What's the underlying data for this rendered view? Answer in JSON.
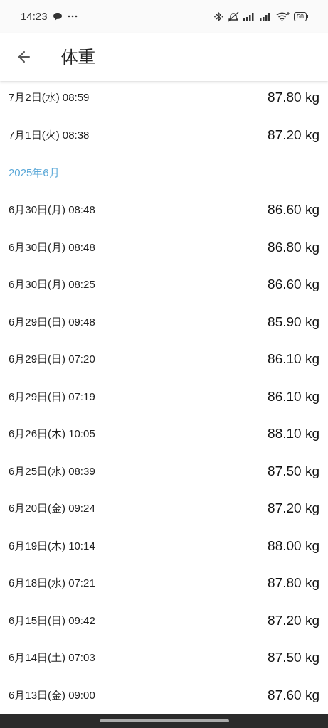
{
  "status_bar": {
    "time": "14:23",
    "battery": "58"
  },
  "header": {
    "title": "体重"
  },
  "sections": [
    {
      "rows": [
        {
          "date": "7月2日(水) 08:59",
          "weight": "87.80 kg"
        },
        {
          "date": "7月1日(火) 08:38",
          "weight": "87.20 kg"
        }
      ]
    },
    {
      "title": "2025年6月",
      "rows": [
        {
          "date": "6月30日(月) 08:48",
          "weight": "86.60 kg"
        },
        {
          "date": "6月30日(月) 08:48",
          "weight": "86.80 kg"
        },
        {
          "date": "6月30日(月) 08:25",
          "weight": "86.60 kg"
        },
        {
          "date": "6月29日(日) 09:48",
          "weight": "85.90 kg"
        },
        {
          "date": "6月29日(日) 07:20",
          "weight": "86.10 kg"
        },
        {
          "date": "6月29日(日) 07:19",
          "weight": "86.10 kg"
        },
        {
          "date": "6月26日(木) 10:05",
          "weight": "88.10 kg"
        },
        {
          "date": "6月25日(水) 08:39",
          "weight": "87.50 kg"
        },
        {
          "date": "6月20日(金) 09:24",
          "weight": "87.20 kg"
        },
        {
          "date": "6月19日(木) 10:14",
          "weight": "88.00 kg"
        },
        {
          "date": "6月18日(水) 07:21",
          "weight": "87.80 kg"
        },
        {
          "date": "6月15日(日) 09:42",
          "weight": "87.20 kg"
        },
        {
          "date": "6月14日(土) 07:03",
          "weight": "87.50 kg"
        },
        {
          "date": "6月13日(金) 09:00",
          "weight": "87.60 kg"
        }
      ]
    }
  ]
}
